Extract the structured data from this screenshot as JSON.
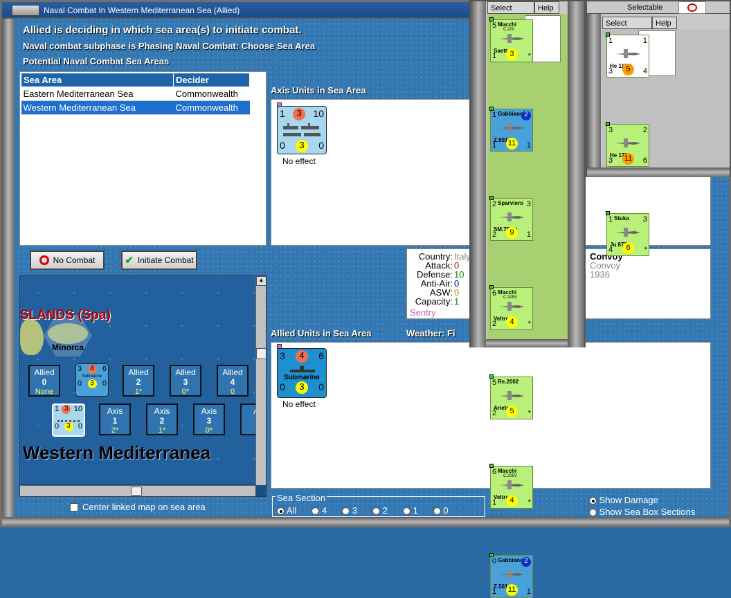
{
  "window": {
    "title": "Naval Combat In Western Mediterranean Sea (Allied)"
  },
  "header": {
    "line1": "Allied is deciding in which sea area(s) to initiate combat.",
    "line2": "Naval combat subphase is Phasing Naval Combat: Choose Sea Area",
    "line3": "Potential Naval Combat Sea Areas"
  },
  "sea_table": {
    "columns": [
      "Sea Area",
      "Decider"
    ],
    "rows": [
      [
        "Eastern Mediterranean Sea",
        "Commonwealth"
      ],
      [
        "Western Mediterranean Sea",
        "Commonwealth"
      ]
    ]
  },
  "axis_units": {
    "label": "Axis Units in Sea Area",
    "counter": {
      "tl": "1",
      "badge": "3",
      "tr": "10",
      "bl": "0",
      "bm": "3",
      "br": "0",
      "effect": "No effect"
    }
  },
  "allied_units": {
    "label": "Allied Units in Sea Area",
    "counter": {
      "tl": "3",
      "badge": "4",
      "tr": "6",
      "name": "Submarine",
      "bl": "0",
      "bm": "3",
      "br": "0",
      "effect": "No effect"
    }
  },
  "weather": {
    "label": "Weather:",
    "value": "Fi"
  },
  "buttons": {
    "no_combat": "No Combat",
    "initiate": "Initiate Combat"
  },
  "map": {
    "region_label": "SLANDS (Spa)",
    "island": "Minorca",
    "sea_name": "Western Mediterranea",
    "allied_boxes": [
      {
        "title": "Allied",
        "num": "0",
        "sub": "None"
      },
      {
        "title": "Allied",
        "num": "2",
        "sub": "1*"
      },
      {
        "title": "Allied",
        "num": "3",
        "sub": "0*"
      },
      {
        "title": "Allied",
        "num": "4",
        "sub": "0"
      }
    ],
    "axis_boxes": [
      {
        "title": "Axis",
        "num": "1",
        "sub": "2*"
      },
      {
        "title": "Axis",
        "num": "2",
        "sub": "1*"
      },
      {
        "title": "Axis",
        "num": "3",
        "sub": "0*"
      },
      {
        "title": "A",
        "num": "",
        "sub": ""
      }
    ],
    "sub_counter": {
      "tl": "3",
      "badge": "4",
      "tr": "6",
      "name": "Submarine",
      "bl": "0",
      "bm": "3",
      "br": "0"
    },
    "axis_counter": {
      "tl": "1",
      "badge": "3",
      "tr": "10",
      "bl": "0",
      "bm": "3",
      "br": "0"
    }
  },
  "center_linked": "Center linked map on sea area",
  "info": {
    "labels": [
      "Country:",
      "Attack:",
      "Defense:",
      "Anti-Air:",
      "ASW:",
      "Capacity:"
    ],
    "values": [
      "Italy",
      "0",
      "10",
      "0",
      "0",
      "1"
    ],
    "status": "Sentry",
    "unit_name": "Convoy",
    "unit_type": "Convoy",
    "year": "1936"
  },
  "sea_section": {
    "label": "Sea Section",
    "options": [
      "All",
      "4",
      "3",
      "2",
      "1",
      "0"
    ],
    "selected": "All"
  },
  "show": {
    "damage": "Show Damage",
    "sections": "Show Sea Box Sections"
  },
  "italian_panel": {
    "select": "Select",
    "help": "Help",
    "cards": [
      {
        "tl": "5",
        "name": "Macchi",
        "sub": "C.200",
        "label": "Saetta",
        "bl": "1",
        "mid": "3",
        "br": "*",
        "bg": "#b8f07a",
        "circle": "#ffff00"
      },
      {
        "tl": "1",
        "name": "Gabbiano",
        "sub": "",
        "label": "Z.501",
        "bl": "1",
        "mid": "11",
        "br": "1",
        "bg": "#4aa0d8",
        "circle": "#ffff00",
        "badge": "2"
      },
      {
        "tl": "2",
        "name": "Sparviero",
        "sub": "",
        "label": "SM.79bis",
        "bl": "2",
        "mid": "9",
        "br": "1",
        "bg": "#b8f07a",
        "circle": "#ffff00",
        "tr": "3"
      },
      {
        "tl": "6",
        "name": "Macchi",
        "sub": "C.205V",
        "label": "Veltro",
        "bl": "2",
        "mid": "4",
        "br": "*",
        "bg": "#b8f07a",
        "circle": "#ffff00"
      },
      {
        "tl": "5",
        "name": "Re.2002",
        "sub": "",
        "label": "Ariete",
        "bl": "2",
        "mid": "5",
        "br": "*",
        "bg": "#b8f07a",
        "circle": "#ffff00"
      },
      {
        "tl": "6",
        "name": "Macchi",
        "sub": "C.205V",
        "label": "Veltro",
        "bl": "1",
        "mid": "4",
        "br": "*",
        "bg": "#b8f07a",
        "circle": "#ffff00"
      },
      {
        "tl": "0",
        "name": "Gabbiano",
        "sub": "",
        "label": "Z.501",
        "bl": "1",
        "mid": "11",
        "br": "1",
        "bg": "#4aa0d8",
        "circle": "#ffff00",
        "badge": "2"
      }
    ]
  },
  "german_panel": {
    "selectable": "Selectable",
    "select": "Select",
    "help": "Help",
    "cards": [
      {
        "tl": "1",
        "tr": "1",
        "label": "He 111H",
        "bl": "3",
        "mid": "5",
        "br": "4",
        "bg": "#fff",
        "circle": "#ff9a00"
      },
      {
        "tl": "3",
        "tr": "2",
        "label": "He 177",
        "bl": "3",
        "mid": "11",
        "br": "6",
        "bg": "#b8f07a",
        "circle": "#ff9a00"
      },
      {
        "tl": "1",
        "tr": "3",
        "label": "Ju 87R",
        "bl": "4",
        "mid": "6",
        "br": "*",
        "bg": "#b8f07a",
        "circle": "#ffff00",
        "name": "Stuka"
      }
    ]
  },
  "colors": {
    "selection": "#1f6fd0",
    "header_bg": "#1d64a8",
    "attack": "#d00000",
    "defense": "#008000",
    "aa": "#0000c0",
    "asw": "#e08000",
    "capacity": "#008000",
    "sentry": "#d060b0"
  }
}
